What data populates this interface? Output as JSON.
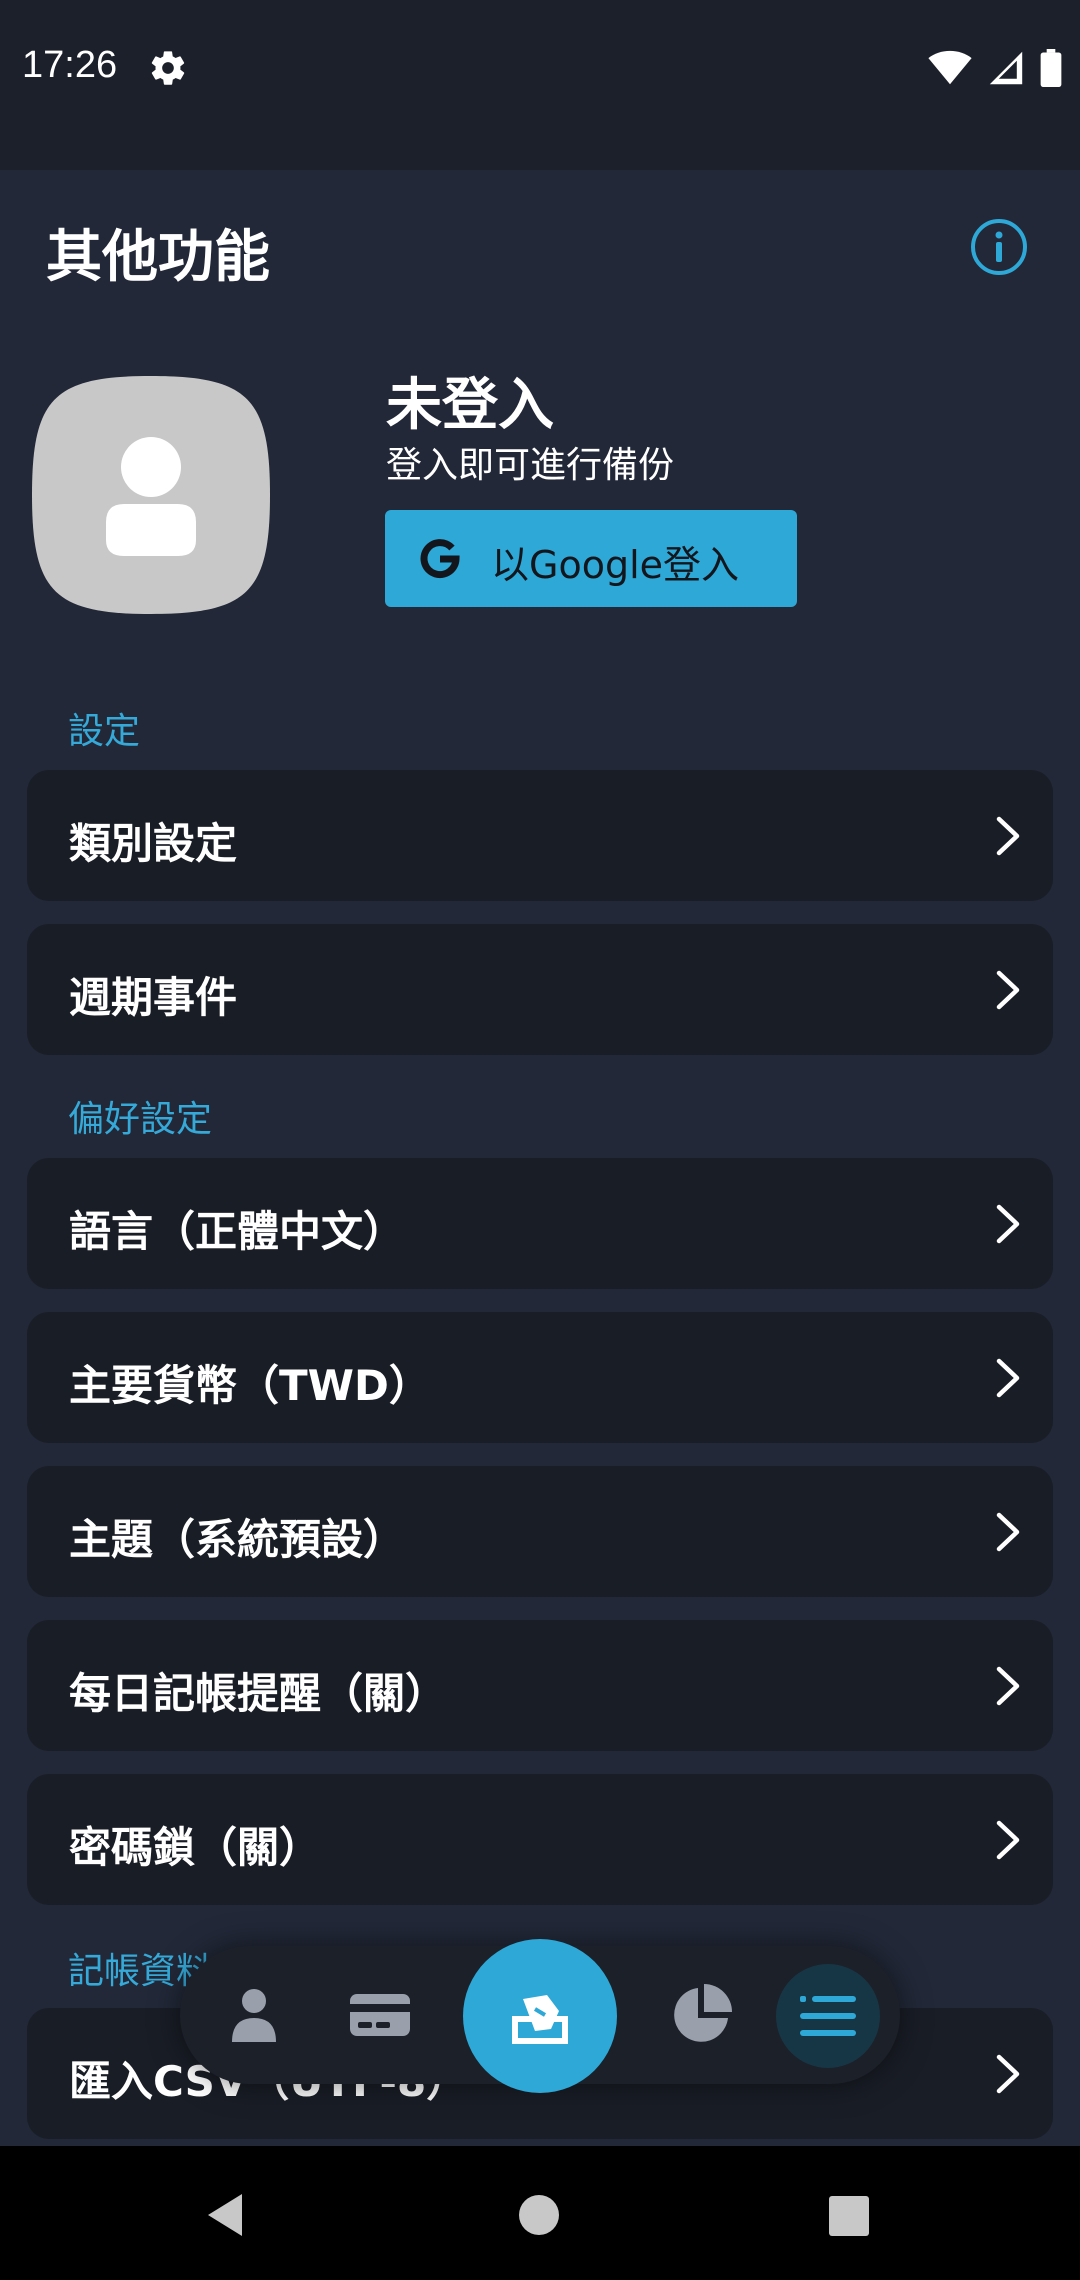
{
  "status_bar": {
    "time": "17:26"
  },
  "header": {
    "title": "其他功能"
  },
  "profile": {
    "name": "未登入",
    "subtitle": "登入即可進行備份",
    "google_button_label": "以Google登入"
  },
  "sections": {
    "settings": {
      "label": "設定"
    },
    "preferences": {
      "label": "偏好設定"
    },
    "data": {
      "label": "記帳資料"
    }
  },
  "menu": {
    "category_settings": "類別設定",
    "recurring_events": "週期事件",
    "language": "語言（正體中文）",
    "currency": "主要貨幣（TWD）",
    "theme": "主題（系統預設）",
    "daily_reminder": "每日記帳提醒（關）",
    "passcode_lock": "密碼鎖（關）",
    "import_csv": "匯入CSV（UTF-8）"
  },
  "bottom_nav": {
    "items": [
      "person-icon",
      "card-icon",
      "add-record-icon",
      "pie-chart-icon",
      "menu-icon"
    ],
    "active": "menu-icon"
  },
  "colors": {
    "background": "#222838",
    "card": "#191d26",
    "accent": "#2ea8d6",
    "section_label": "#35a9d8"
  }
}
